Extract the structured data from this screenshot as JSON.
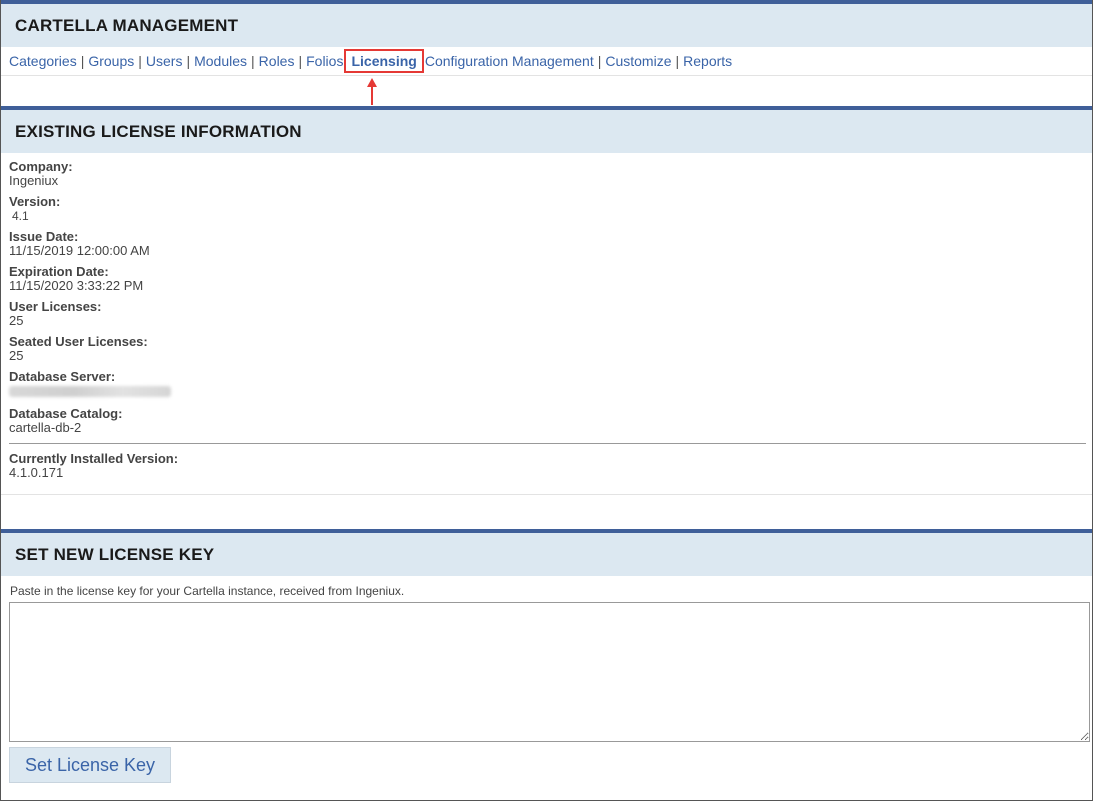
{
  "header": {
    "title": "CARTELLA MANAGEMENT"
  },
  "nav": {
    "items": [
      {
        "label": "Categories"
      },
      {
        "label": "Groups"
      },
      {
        "label": "Users"
      },
      {
        "label": "Modules"
      },
      {
        "label": "Roles"
      },
      {
        "label": "Folios"
      },
      {
        "label": "Licensing",
        "active": true
      },
      {
        "label": "Configuration Management"
      },
      {
        "label": "Customize"
      },
      {
        "label": "Reports"
      }
    ],
    "separator": "|",
    "highlight_color": "#e53935"
  },
  "license_info": {
    "title": "EXISTING LICENSE INFORMATION",
    "fields": [
      {
        "label": "Company:",
        "value": "Ingeniux"
      },
      {
        "label": "Version:",
        "value": "4.1"
      },
      {
        "label": "Issue Date:",
        "value": "11/15/2019 12:00:00 AM"
      },
      {
        "label": "Expiration Date:",
        "value": "11/15/2020 3:33:22 PM"
      },
      {
        "label": "User Licenses:",
        "value": "25"
      },
      {
        "label": "Seated User Licenses:",
        "value": "25"
      },
      {
        "label": "Database Server:",
        "value": "",
        "blurred": true
      },
      {
        "label": "Database Catalog:",
        "value": "cartella-db-2"
      }
    ],
    "installed": {
      "label": "Currently Installed Version:",
      "value": "4.1.0.171"
    }
  },
  "license_key": {
    "title": "SET NEW LICENSE KEY",
    "instructions": "Paste in the license key for your Cartella instance, received from Ingeniux.",
    "textarea_value": "",
    "button_label": "Set License Key"
  },
  "colors": {
    "header_bg": "#dce8f1",
    "header_border": "#3f5f99",
    "link": "#3a64a8"
  }
}
